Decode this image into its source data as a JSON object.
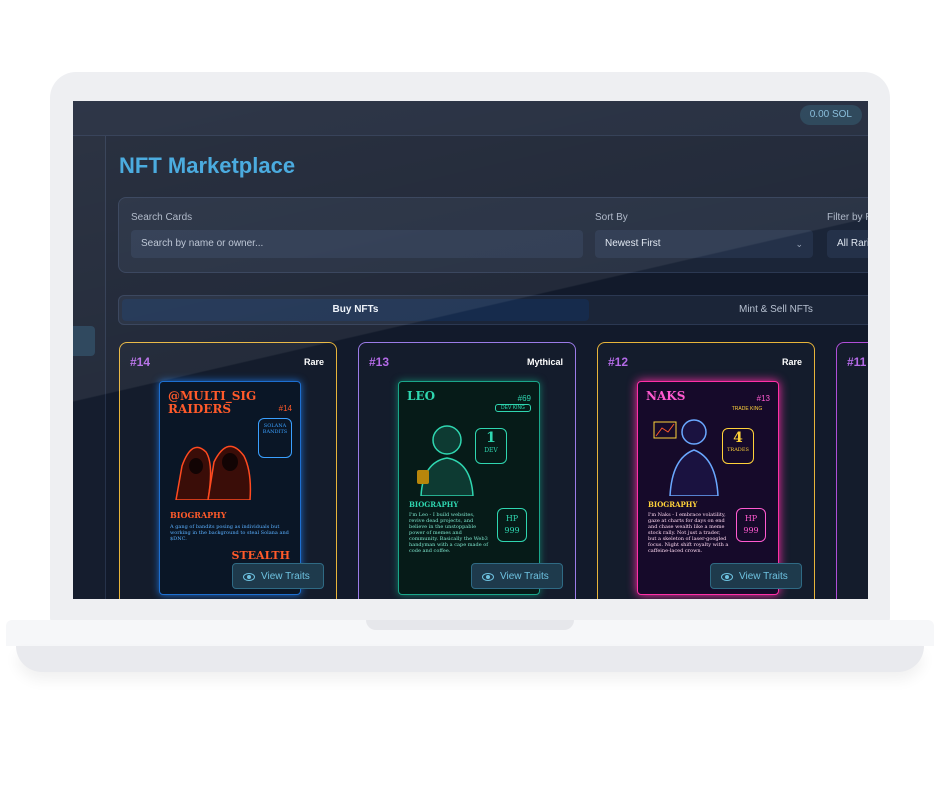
{
  "topbar": {
    "balance": "0.00 SOL"
  },
  "page": {
    "title": "NFT Marketplace"
  },
  "filters": {
    "search_label": "Search Cards",
    "search_placeholder": "Search by name or owner...",
    "sort_label": "Sort By",
    "sort_value": "Newest First",
    "rarity_label": "Filter by R",
    "rarity_value": "All Rari"
  },
  "tabs": {
    "buy": "Buy NFTs",
    "mint": "Mint & Sell NFTs"
  },
  "cards": [
    {
      "number": "#14",
      "rarity": "Rare",
      "view_label": "View Traits",
      "art_title": "@MULTI_SIG RAIDERS",
      "art_tag": "#14",
      "badge": "SOLANA BANDITS",
      "bio_heading": "BIOGRAPHY",
      "bio": "A gang of bandits posing as individuals but working in the background to steal Solana and $DNC.",
      "footer": "STEALTH OPE"
    },
    {
      "number": "#13",
      "rarity": "Mythical",
      "view_label": "View Traits",
      "art_title": "LEO",
      "art_tag": "#69",
      "badge": "DEV KING",
      "rank": "1",
      "rank_label": "DEV",
      "bio_heading": "BIOGRAPHY",
      "bio": "I'm Leo - I build websites, revive dead projects, and believe in the unstoppable power of memes and community. Basically the Web3 handyman with a cape made of code and coffee.",
      "hp": "HP 999"
    },
    {
      "number": "#12",
      "rarity": "Rare",
      "view_label": "View Traits",
      "art_title": "NAKS",
      "art_tag": "#13",
      "badge": "TRADE KING",
      "rank": "4",
      "rank_label": "TRADES",
      "bio_heading": "BIOGRAPHY",
      "bio": "I'm Naks - I embrace volatility, gaze at charts for days on end and chase wealth like a meme stock rally. Not just a trader, but a skeleton of laser-googled focus. Night shift royalty with a caffeine-laced crown.",
      "hp": "HP 999"
    },
    {
      "number": "#11"
    }
  ],
  "colors": {
    "rare": "#e7b43a",
    "mythical": "#9b7be8",
    "card4": "#b04ed8",
    "accent": "#39a3dc"
  }
}
